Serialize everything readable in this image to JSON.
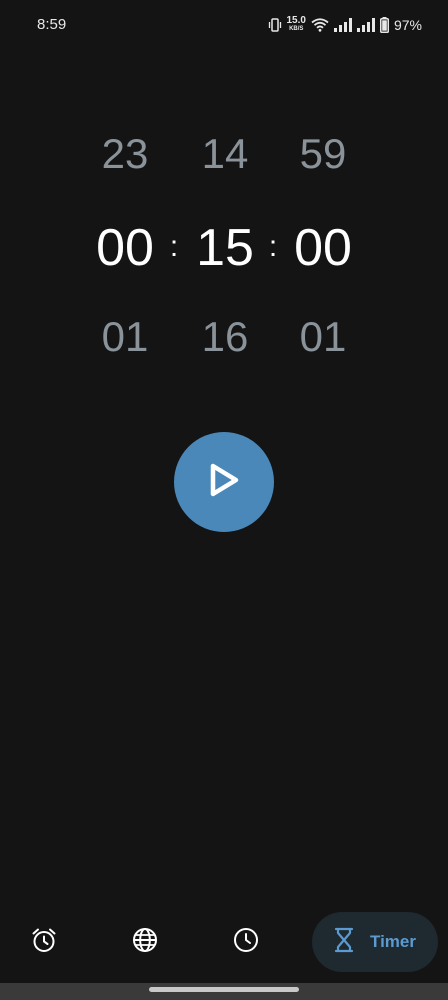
{
  "status_bar": {
    "time": "8:59",
    "net_speed_value": "15.0",
    "net_speed_unit": "KB/S",
    "battery": "97%",
    "icons": [
      "vibrate-icon",
      "wifi-icon",
      "signal-icon",
      "signal-icon",
      "battery-icon"
    ]
  },
  "picker": {
    "above": {
      "hours": "23",
      "minutes": "14",
      "seconds": "59"
    },
    "selected": {
      "hours": "00",
      "minutes": "15",
      "seconds": "00"
    },
    "below": {
      "hours": "01",
      "minutes": "16",
      "seconds": "01"
    },
    "separator": ":"
  },
  "controls": {
    "play_icon": "play-icon"
  },
  "bottom_nav": {
    "items": [
      {
        "icon": "alarm-icon",
        "label": ""
      },
      {
        "icon": "globe-icon",
        "label": ""
      },
      {
        "icon": "clock-icon",
        "label": ""
      },
      {
        "icon": "hourglass-icon",
        "label": "Timer"
      }
    ],
    "active_index": 3
  },
  "colors": {
    "background": "#141414",
    "accent": "#4a88ba",
    "accent_text": "#5b9bd0",
    "faded_digits": "#8a939a",
    "active_nav_bg": "#1f2930"
  }
}
